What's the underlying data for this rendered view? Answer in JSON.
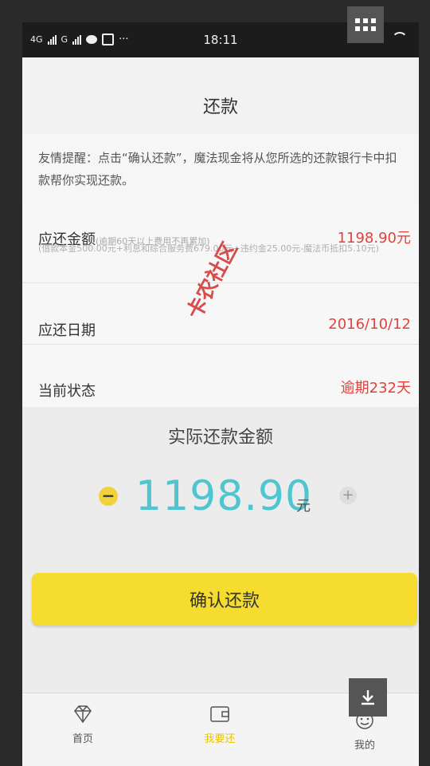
{
  "status_bar": {
    "network_1": "4G",
    "network_2": "G",
    "extra": "···",
    "time": "18:11",
    "battery_level": 0.8
  },
  "nav": {
    "title": "还款"
  },
  "tip": {
    "text": "友情提醒：点击“确认还款”，魔法现金将从您所选的还款银行卡中扣款帮你实现还款。"
  },
  "due_amount": {
    "label": "应还金额",
    "note": "(逾期60天以上费用不再累加)",
    "value": "1198.90元",
    "breakdown": "(借款本金500.00元+利息和综合服务费679.00元+违约金25.00元-魔法币抵扣5.10元)"
  },
  "due_date": {
    "label": "应还日期",
    "value": "2016/10/12"
  },
  "status": {
    "label": "当前状态",
    "value": "逾期232天"
  },
  "actual": {
    "label": "实际还款金额",
    "minus": "−",
    "amount": "1198.90",
    "unit": "元",
    "plus": "+"
  },
  "confirm_button": "确认还款",
  "watermark": "卡农社区",
  "tabs": [
    {
      "label": "首页",
      "icon": "diamond-icon"
    },
    {
      "label": "我要还",
      "icon": "wallet-icon",
      "active": true
    },
    {
      "label": "我的",
      "icon": "face-icon"
    }
  ],
  "colors": {
    "accent_yellow": "#f6dc2e",
    "amount_cyan": "#4fc5d0",
    "warning_red": "#e0433e"
  }
}
